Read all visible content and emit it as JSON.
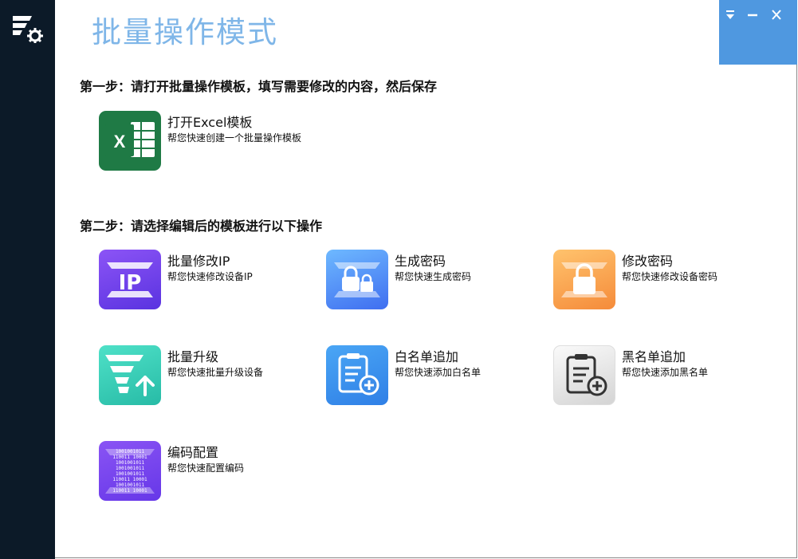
{
  "window": {
    "title": "批量操作模式",
    "controls": {
      "menu_icon": "dropdown-menu-icon",
      "minimize_icon": "minimize-icon",
      "close_icon": "close-icon"
    }
  },
  "sidebar": {
    "logo_icon": "app-logo-settings-icon"
  },
  "steps": {
    "step1": "第一步：请打开批量操作模板，填写需要修改的内容，然后保存",
    "step2": "第二步：请选择编辑后的模板进行以下操作"
  },
  "actions": {
    "excel": {
      "title": "打开Excel模板",
      "subtitle": "帮您快速创建一个批量操作模板",
      "icon": "excel-icon"
    },
    "modify_ip": {
      "title": "批量修改IP",
      "subtitle": "帮您快速修改设备IP",
      "icon": "ip-icon"
    },
    "gen_pwd": {
      "title": "生成密码",
      "subtitle": "帮您快速生成密码",
      "icon": "generate-password-lock-icon"
    },
    "mod_pwd": {
      "title": "修改密码",
      "subtitle": "帮您快速修改设备密码",
      "icon": "modify-password-lock-icon"
    },
    "upgrade": {
      "title": "批量升级",
      "subtitle": "帮您快速批量升级设备",
      "icon": "upgrade-arrow-icon"
    },
    "whitelist": {
      "title": "白名单追加",
      "subtitle": "帮您快速添加白名单",
      "icon": "whitelist-clipboard-add-icon"
    },
    "blacklist": {
      "title": "黑名单追加",
      "subtitle": "帮您快速添加黑名单",
      "icon": "blacklist-clipboard-add-icon"
    },
    "encoding": {
      "title": "编码配置",
      "subtitle": "帮您快速配置编码",
      "icon": "binary-code-icon"
    }
  },
  "colors": {
    "sidebar_bg": "#0c1a28",
    "title_color": "#7fb6e8",
    "window_controls_bg": "#4f98e0",
    "excel_green": "#1f7a45"
  }
}
